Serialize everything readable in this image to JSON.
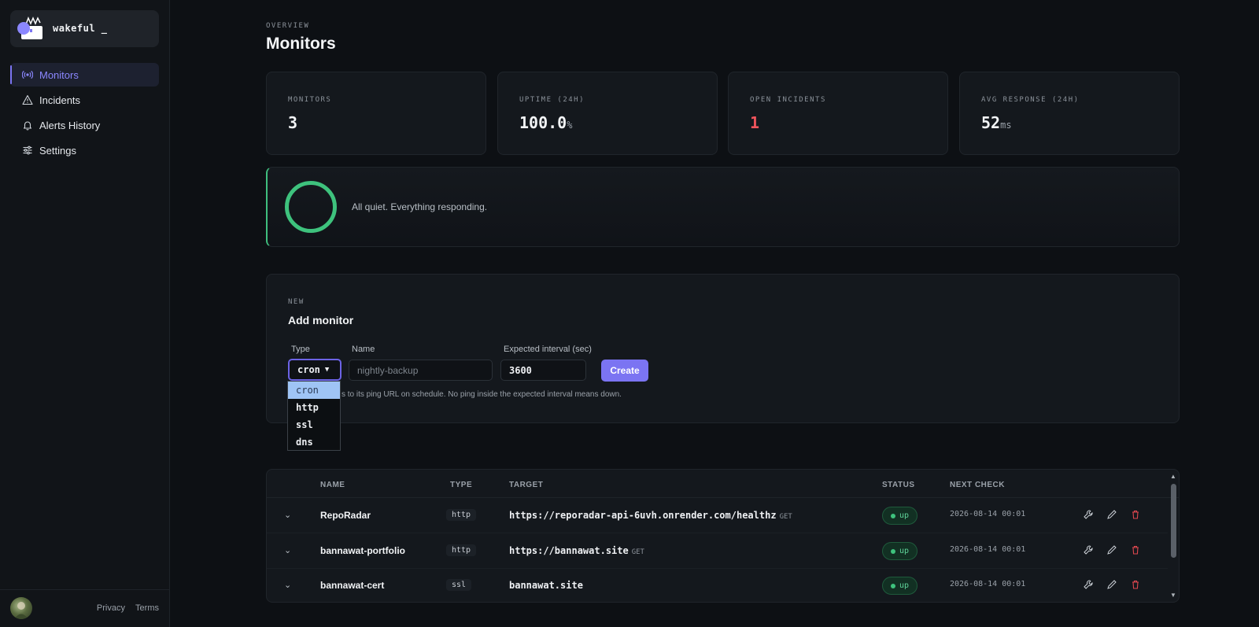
{
  "brand": {
    "name": "wakeful _"
  },
  "nav": [
    {
      "label": "Monitors",
      "icon": "broadcast-icon",
      "active": true
    },
    {
      "label": "Incidents",
      "icon": "warning-icon",
      "active": false
    },
    {
      "label": "Alerts History",
      "icon": "bell-icon",
      "active": false
    },
    {
      "label": "Settings",
      "icon": "sliders-icon",
      "active": false
    }
  ],
  "footer": {
    "privacy": "Privacy",
    "terms": "Terms"
  },
  "page": {
    "eyebrow": "OVERVIEW",
    "title": "Monitors"
  },
  "stats": [
    {
      "label": "MONITORS",
      "value": "3",
      "unit": ""
    },
    {
      "label": "UPTIME (24H)",
      "value": "100.0",
      "unit": "%"
    },
    {
      "label": "OPEN INCIDENTS",
      "value": "1",
      "unit": ""
    },
    {
      "label": "AVG RESPONSE (24H)",
      "value": "52",
      "unit": "ms"
    }
  ],
  "status": {
    "message": "All quiet. Everything responding.",
    "color": "#3ec27d"
  },
  "add_monitor": {
    "eyebrow": "NEW",
    "title": "Add monitor",
    "type_label": "Type",
    "type_value": "cron",
    "name_label": "Name",
    "name_placeholder": "nightly-backup",
    "interval_label": "Expected interval (sec)",
    "interval_value": "3600",
    "create_label": "Create",
    "help_text": "s to its ping URL on schedule. No ping inside the expected interval means down.",
    "type_options": [
      "cron",
      "http",
      "ssl",
      "dns"
    ]
  },
  "table": {
    "headers": {
      "name": "NAME",
      "type": "TYPE",
      "target": "TARGET",
      "status": "STATUS",
      "next": "NEXT CHECK"
    },
    "rows": [
      {
        "name": "RepoRadar",
        "type": "http",
        "target": "https://reporadar-api-6uvh.onrender.com/healthz",
        "method": "GET",
        "status": "up",
        "next": "2026-08-14 00:01"
      },
      {
        "name": "bannawat-portfolio",
        "type": "http",
        "target": "https://bannawat.site",
        "method": "GET",
        "status": "up",
        "next": "2026-08-14 00:01"
      },
      {
        "name": "bannawat-cert",
        "type": "ssl",
        "target": "bannawat.site",
        "method": "",
        "status": "up",
        "next": "2026-08-14 00:01"
      }
    ]
  },
  "colors": {
    "accent": "#7b74f2",
    "success": "#3ec27d",
    "danger": "#f0545c"
  }
}
